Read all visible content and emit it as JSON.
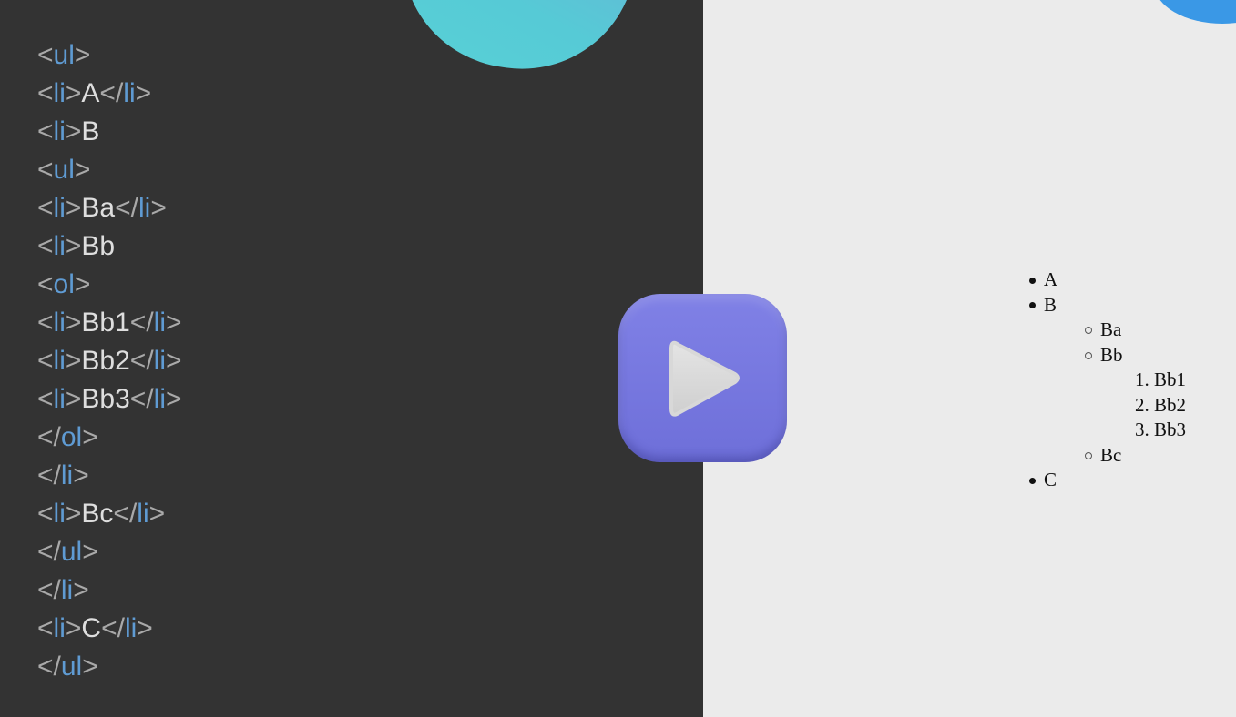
{
  "code_lines": [
    [
      [
        "br",
        "<"
      ],
      [
        "tag",
        "ul"
      ],
      [
        "br",
        ">"
      ]
    ],
    [
      [
        "br",
        "<"
      ],
      [
        "tag",
        "li"
      ],
      [
        "br",
        ">"
      ],
      [
        "txt",
        "A"
      ],
      [
        "br",
        "</"
      ],
      [
        "tag",
        "li"
      ],
      [
        "br",
        ">"
      ]
    ],
    [
      [
        "br",
        "<"
      ],
      [
        "tag",
        "li"
      ],
      [
        "br",
        ">"
      ],
      [
        "txt",
        "B"
      ]
    ],
    [
      [
        "br",
        "<"
      ],
      [
        "tag",
        "ul"
      ],
      [
        "br",
        ">"
      ]
    ],
    [
      [
        "br",
        "<"
      ],
      [
        "tag",
        "li"
      ],
      [
        "br",
        ">"
      ],
      [
        "txt",
        "Ba"
      ],
      [
        "br",
        "</"
      ],
      [
        "tag",
        "li"
      ],
      [
        "br",
        ">"
      ]
    ],
    [
      [
        "br",
        "<"
      ],
      [
        "tag",
        "li"
      ],
      [
        "br",
        ">"
      ],
      [
        "txt",
        "Bb"
      ]
    ],
    [
      [
        "br",
        "<"
      ],
      [
        "tag",
        "ol"
      ],
      [
        "br",
        ">"
      ]
    ],
    [
      [
        "br",
        "<"
      ],
      [
        "tag",
        "li"
      ],
      [
        "br",
        ">"
      ],
      [
        "txt",
        "Bb1"
      ],
      [
        "br",
        "</"
      ],
      [
        "tag",
        "li"
      ],
      [
        "br",
        ">"
      ]
    ],
    [
      [
        "br",
        "<"
      ],
      [
        "tag",
        "li"
      ],
      [
        "br",
        ">"
      ],
      [
        "txt",
        "Bb2"
      ],
      [
        "br",
        "</"
      ],
      [
        "tag",
        "li"
      ],
      [
        "br",
        ">"
      ]
    ],
    [
      [
        "br",
        "<"
      ],
      [
        "tag",
        "li"
      ],
      [
        "br",
        ">"
      ],
      [
        "txt",
        "Bb3"
      ],
      [
        "br",
        "</"
      ],
      [
        "tag",
        "li"
      ],
      [
        "br",
        ">"
      ]
    ],
    [
      [
        "br",
        "</"
      ],
      [
        "tag",
        "ol"
      ],
      [
        "br",
        ">"
      ]
    ],
    [
      [
        "br",
        "</"
      ],
      [
        "tag",
        "li"
      ],
      [
        "br",
        ">"
      ]
    ],
    [
      [
        "br",
        "<"
      ],
      [
        "tag",
        "li"
      ],
      [
        "br",
        ">"
      ],
      [
        "txt",
        "Bc"
      ],
      [
        "br",
        "</"
      ],
      [
        "tag",
        "li"
      ],
      [
        "br",
        ">"
      ]
    ],
    [
      [
        "br",
        "</"
      ],
      [
        "tag",
        "ul"
      ],
      [
        "br",
        ">"
      ]
    ],
    [
      [
        "br",
        "</"
      ],
      [
        "tag",
        "li"
      ],
      [
        "br",
        ">"
      ]
    ],
    [
      [
        "br",
        "<"
      ],
      [
        "tag",
        "li"
      ],
      [
        "br",
        ">"
      ],
      [
        "txt",
        "C"
      ],
      [
        "br",
        "</"
      ],
      [
        "tag",
        "li"
      ],
      [
        "br",
        ">"
      ]
    ],
    [
      [
        "br",
        "</"
      ],
      [
        "tag",
        "ul"
      ],
      [
        "br",
        ">"
      ]
    ]
  ],
  "rendered_list": [
    {
      "level": 1,
      "marker": "disc",
      "text": "A"
    },
    {
      "level": 1,
      "marker": "disc",
      "text": "B"
    },
    {
      "level": 2,
      "marker": "circle",
      "text": "Ba"
    },
    {
      "level": 2,
      "marker": "circle",
      "text": "Bb"
    },
    {
      "level": 3,
      "marker": "1.",
      "text": "Bb1"
    },
    {
      "level": 3,
      "marker": "2.",
      "text": "Bb2"
    },
    {
      "level": 3,
      "marker": "3.",
      "text": "Bb3"
    },
    {
      "level": 2,
      "marker": "circle",
      "text": "Bc"
    },
    {
      "level": 1,
      "marker": "disc",
      "text": "C"
    }
  ],
  "play_button": {
    "icon": "play-icon",
    "color": "#7576de"
  },
  "colors": {
    "code_bg": "#333333",
    "preview_bg": "#ebebeb",
    "tag": "#5f9bd3",
    "bracket": "#a9a9a9",
    "text": "#dedede"
  }
}
